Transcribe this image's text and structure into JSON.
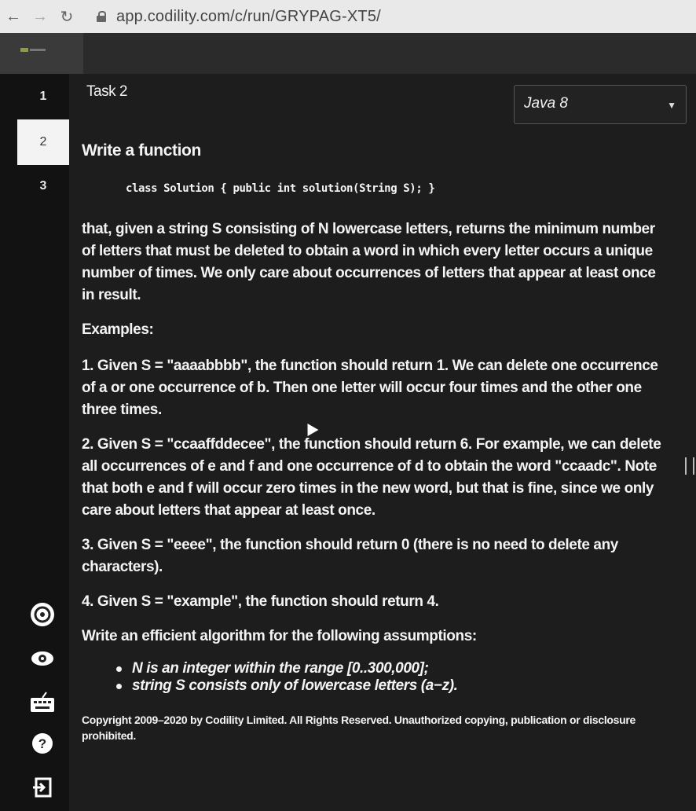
{
  "browser": {
    "url": "app.codility.com/c/run/GRYPAG-XT5/",
    "back_icon": "back-arrow-icon",
    "forward_icon": "forward-arrow-icon",
    "reload_icon": "reload-icon",
    "lock_icon": "lock-icon"
  },
  "sidebar": {
    "tabs": [
      {
        "label": "1"
      },
      {
        "label": "2"
      },
      {
        "label": "3"
      }
    ],
    "icons": [
      "settings-icon",
      "eye-icon",
      "keyboard-icon",
      "help-icon",
      "exit-icon"
    ],
    "help_glyph": "?"
  },
  "task": {
    "title": "Task 2",
    "language": "Java 8"
  },
  "content": {
    "heading": "Write a function",
    "code": "class Solution { public int solution(String S); }",
    "description": "that, given a string S consisting of N lowercase letters, returns the minimum number of letters that must be deleted to obtain a word in which every letter occurs a unique number of times. We only care about occurrences of letters that appear at least once in result.",
    "examples_heading": "Examples:",
    "examples": [
      "1. Given S = \"aaaabbbb\", the function should return 1. We can delete one occurrence of a or one occurrence of b. Then one letter will occur four times and the other one three times.",
      "2. Given S = \"ccaaffddecee\", the function should return 6. For example, we can delete all occurrences of e and f and one occurrence of d to obtain the word \"ccaadc\". Note that both e and f will occur zero times in the new word, but that is fine, since we only care about letters that appear at least once.",
      "3. Given S = \"eeee\", the function should return 0 (there is no need to delete any characters).",
      "4. Given S = \"example\", the function should return 4."
    ],
    "assumptions_heading": "Write an efficient algorithm for the following assumptions:",
    "assumptions": [
      "N is an integer within the range [0..300,000];",
      "string S consists only of lowercase letters (a−z)."
    ],
    "copyright": "Copyright 2009–2020 by Codility Limited. All Rights Reserved. Unauthorized copying, publication or disclosure prohibited."
  }
}
